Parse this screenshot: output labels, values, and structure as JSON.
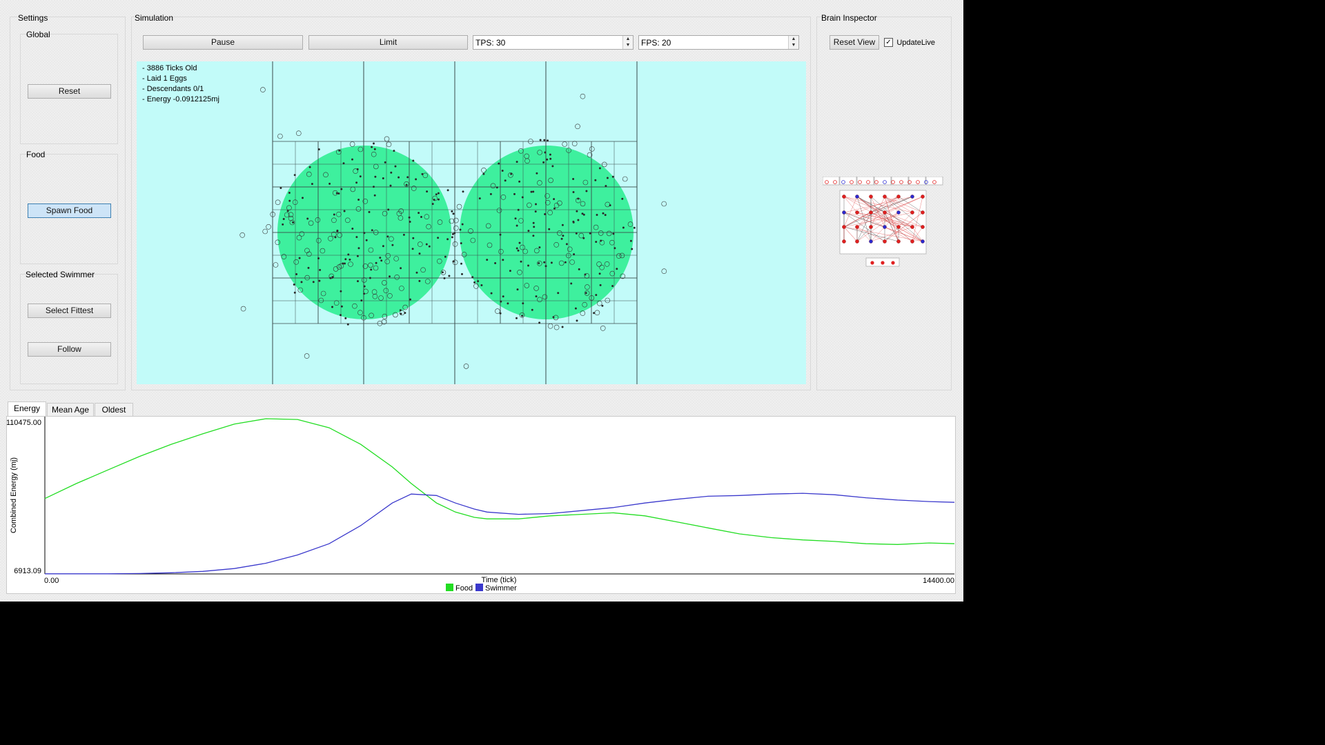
{
  "settings": {
    "title": "Settings",
    "global": {
      "title": "Global",
      "reset_label": "Reset"
    },
    "food": {
      "title": "Food",
      "spawn_label": "Spawn Food"
    },
    "selected": {
      "title": "Selected Swimmer",
      "fittest_label": "Select Fittest",
      "follow_label": "Follow"
    }
  },
  "simulation": {
    "title": "Simulation",
    "pause_label": "Pause",
    "limit_label": "Limit",
    "tps_value": "TPS: 30",
    "fps_value": "FPS: 20",
    "info": [
      "- 3886 Ticks Old",
      "- Laid 1 Eggs",
      "- Descendants 0/1",
      "- Energy -0.0912125mj"
    ],
    "colors": {
      "water": "#c2fbf9",
      "food_zone": "#3ef09e"
    }
  },
  "brain": {
    "title": "Brain Inspector",
    "reset_view_label": "Reset View",
    "update_live_label": "UpdateLive",
    "update_live_checked": true
  },
  "tabs": [
    "Energy",
    "Mean Age",
    "Oldest"
  ],
  "chart_data": {
    "type": "line",
    "xlabel": "Time (tick)",
    "ylabel": "Combined Energy (mj)",
    "xlim": [
      0,
      14400
    ],
    "ylim": [
      6913.09,
      110475.0
    ],
    "x_tick_labels": [
      "0.00",
      "14400.00"
    ],
    "y_tick_labels": [
      "6913.09",
      "110475.00"
    ],
    "legend_position": "bottom-center",
    "series": [
      {
        "name": "Food",
        "color": "#22dd22",
        "x": [
          0,
          500,
          1000,
          1500,
          2000,
          2500,
          3000,
          3500,
          4000,
          4500,
          5000,
          5500,
          5800,
          6200,
          6500,
          6800,
          7000,
          7500,
          8000,
          8500,
          9000,
          9500,
          10000,
          10500,
          11000,
          11500,
          12000,
          12500,
          13000,
          13500,
          14000,
          14400
        ],
        "y": [
          57000,
          67000,
          76000,
          85000,
          93000,
          100000,
          106500,
          110000,
          109500,
          104000,
          93000,
          78000,
          67000,
          54000,
          48000,
          44500,
          43500,
          43500,
          45500,
          46500,
          47500,
          45500,
          41500,
          37500,
          33500,
          31000,
          29500,
          28500,
          27000,
          26500,
          27500,
          27000
        ]
      },
      {
        "name": "Swimmer",
        "color": "#3a38cc",
        "x": [
          0,
          500,
          1000,
          1500,
          2000,
          2500,
          3000,
          3500,
          4000,
          4500,
          5000,
          5500,
          5800,
          6200,
          6500,
          6800,
          7000,
          7500,
          8000,
          8500,
          9000,
          9500,
          10000,
          10500,
          11000,
          11500,
          12000,
          12500,
          13000,
          13500,
          14000,
          14400
        ],
        "y": [
          7000,
          7000,
          7000,
          7200,
          7700,
          8600,
          10500,
          14000,
          19500,
          27000,
          39000,
          54000,
          60000,
          59000,
          54000,
          50000,
          48000,
          46500,
          47000,
          49000,
          51000,
          54000,
          56500,
          58500,
          59000,
          60000,
          60500,
          59500,
          57500,
          56000,
          55000,
          54500
        ]
      }
    ]
  }
}
